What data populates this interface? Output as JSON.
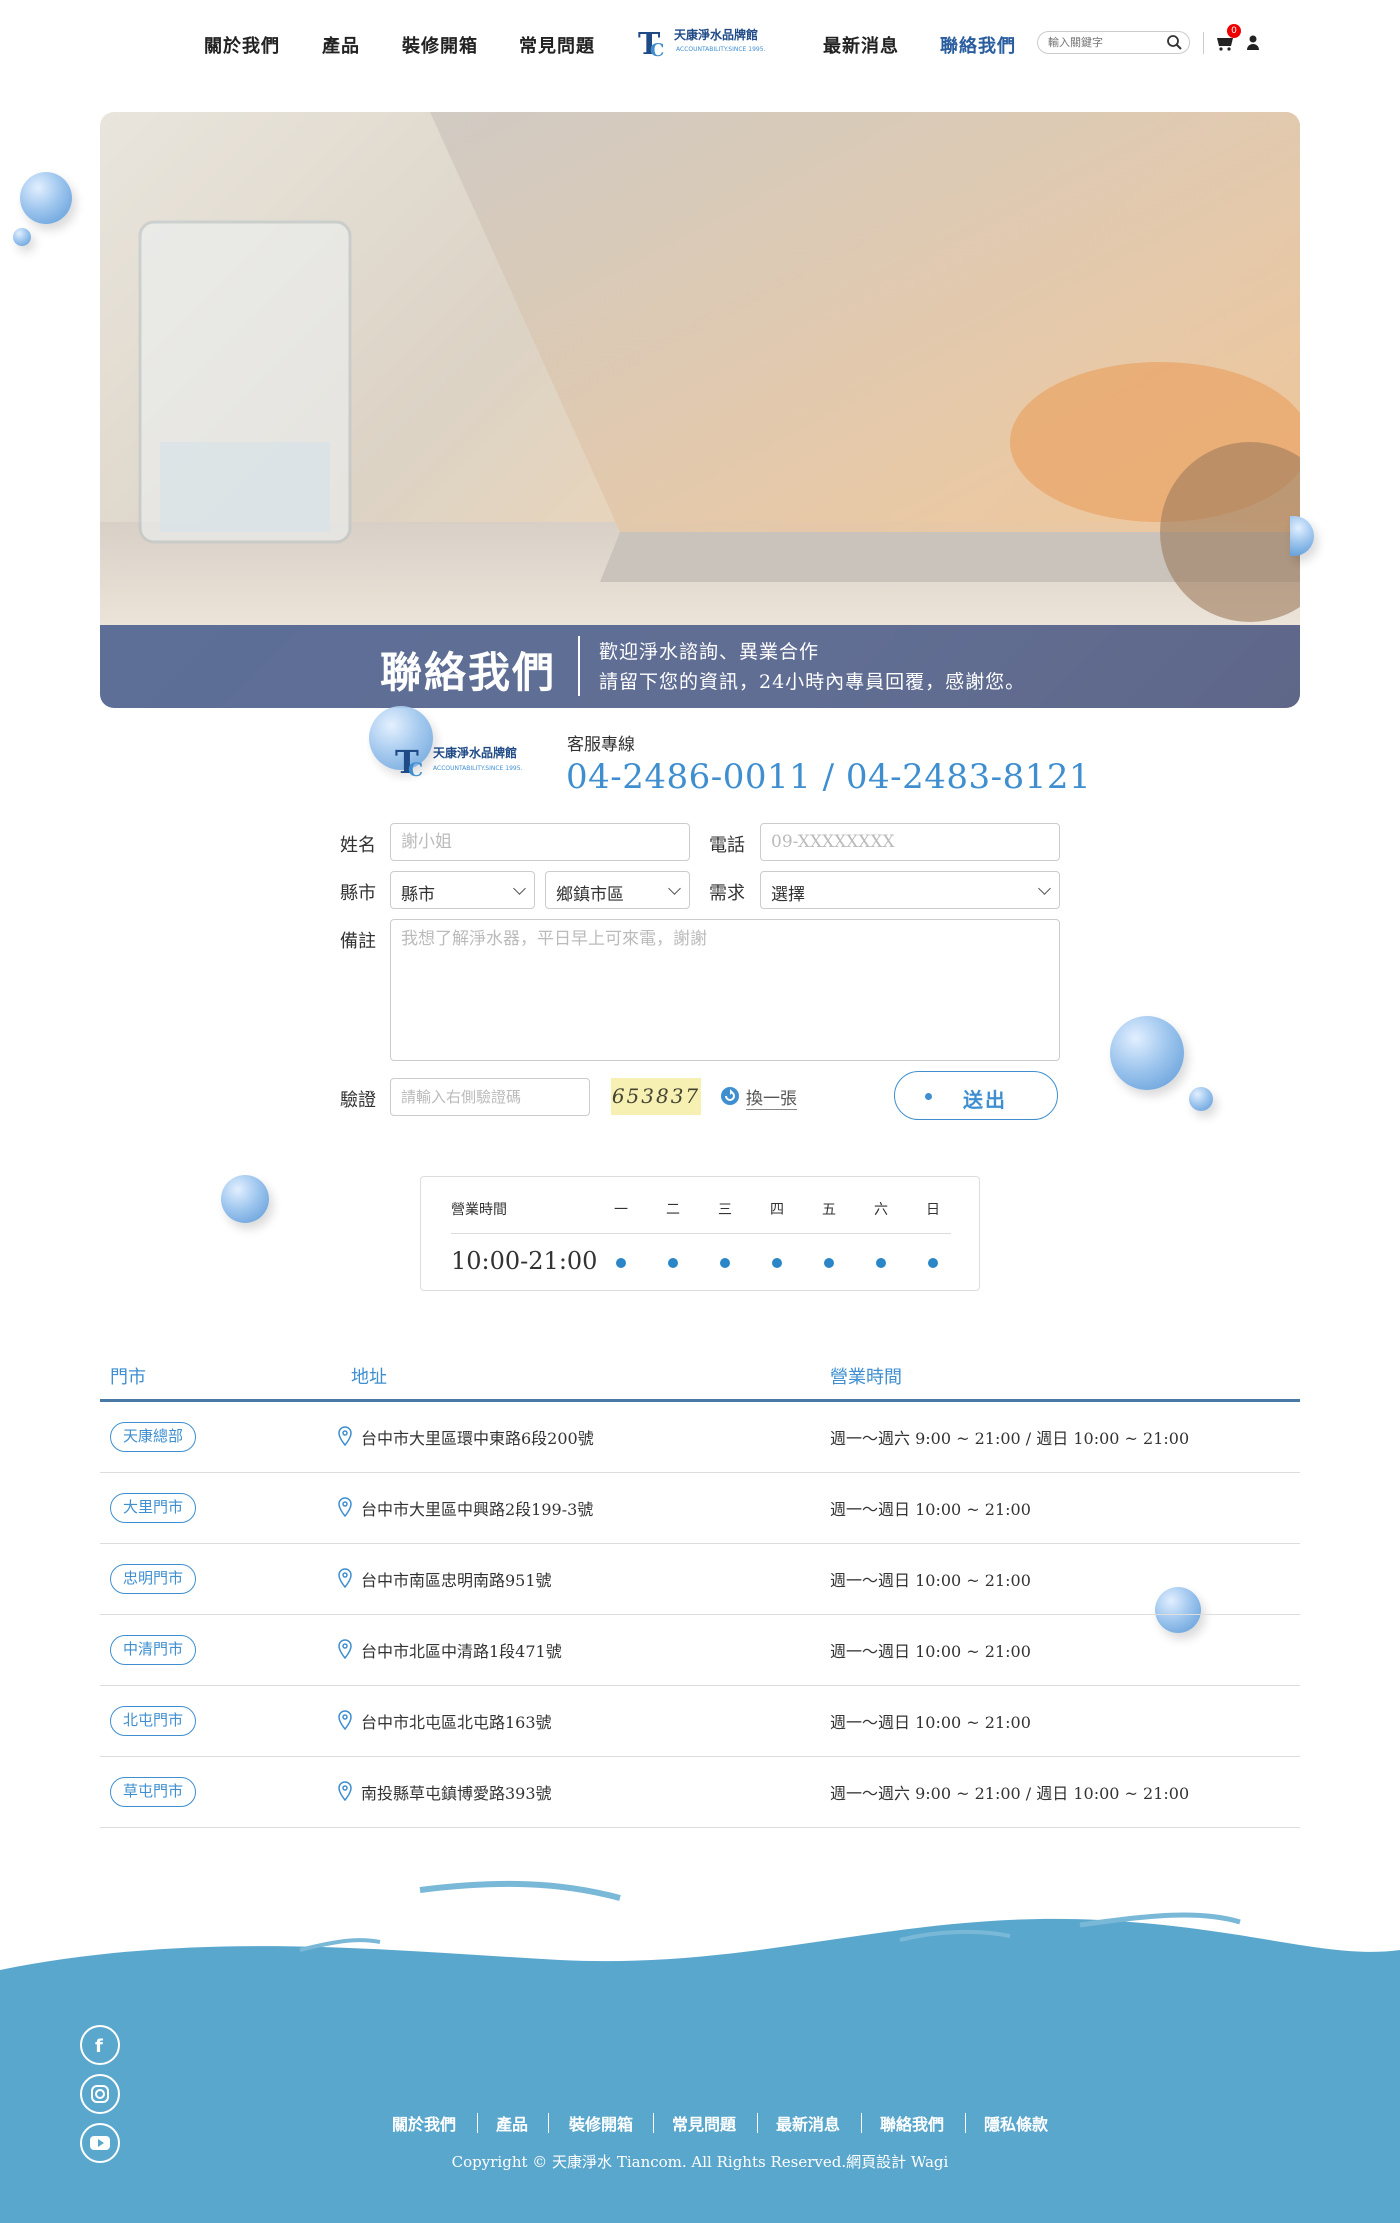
{
  "nav": {
    "items": [
      "關於我們",
      "產品",
      "裝修開箱",
      "常見問題",
      "最新消息",
      "聯絡我們"
    ],
    "search_placeholder": "輸入關鍵字",
    "cart_count": "0",
    "logo_name": "天康淨水品牌館",
    "logo_tagline": "ACCOUNTABILITY.SINCE 1995."
  },
  "hero": {
    "title": "聯絡我們",
    "line1": "歡迎淨水諮詢、異業合作",
    "line2": "請留下您的資訊，24小時內專員回覆，感謝您。"
  },
  "service": {
    "label": "客服專線",
    "phone": "04-2486-0011 / 04-2483-8121"
  },
  "form": {
    "name_label": "姓名",
    "name_placeholder": "謝小姐",
    "phone_label": "電話",
    "phone_placeholder": "09-XXXXXXXX",
    "city_label": "縣市",
    "city_value": "縣市",
    "district_value": "鄉鎮市區",
    "need_label": "需求",
    "need_value": "選擇",
    "note_label": "備註",
    "note_placeholder": "我想了解淨水器，平日早上可來電，謝謝",
    "verify_label": "驗證",
    "verify_placeholder": "請輸入右側驗證碼",
    "captcha_text": "653837",
    "refresh_label": "換一張",
    "submit_label": "送出"
  },
  "hours": {
    "label": "營業時間",
    "days": [
      "一",
      "二",
      "三",
      "四",
      "五",
      "六",
      "日"
    ],
    "time": "10:00-21:00"
  },
  "stores": {
    "headers": [
      "門市",
      "地址",
      "營業時間"
    ],
    "rows": [
      {
        "name": "天康總部",
        "address": "台中市大里區環中東路6段200號",
        "hours": "週一～週六 9:00 ~ 21:00 / 週日 10:00 ~ 21:00"
      },
      {
        "name": "大里門市",
        "address": "台中市大里區中興路2段199-3號",
        "hours": "週一～週日 10:00 ~ 21:00"
      },
      {
        "name": "忠明門市",
        "address": "台中市南區忠明南路951號",
        "hours": "週一～週日 10:00 ~ 21:00"
      },
      {
        "name": "中清門市",
        "address": "台中市北區中清路1段471號",
        "hours": "週一～週日 10:00 ~ 21:00"
      },
      {
        "name": "北屯門市",
        "address": "台中市北屯區北屯路163號",
        "hours": "週一～週日 10:00 ~ 21:00"
      },
      {
        "name": "草屯門市",
        "address": "南投縣草屯鎮博愛路393號",
        "hours": "週一～週六 9:00 ~ 21:00 / 週日 10:00 ~ 21:00"
      }
    ]
  },
  "footer": {
    "links": [
      "關於我們",
      "產品",
      "裝修開箱",
      "常見問題",
      "最新消息",
      "聯絡我們",
      "隱私條款"
    ],
    "copyright": "Copyright © 天康淨水 Tiancom. All Rights Reserved.網頁設計 Wagi"
  },
  "colors": {
    "accent": "#3f8fd0",
    "nav_active": "#2a5d9e",
    "footer": "#5aa7cd",
    "hero_band": "#465c8e"
  }
}
